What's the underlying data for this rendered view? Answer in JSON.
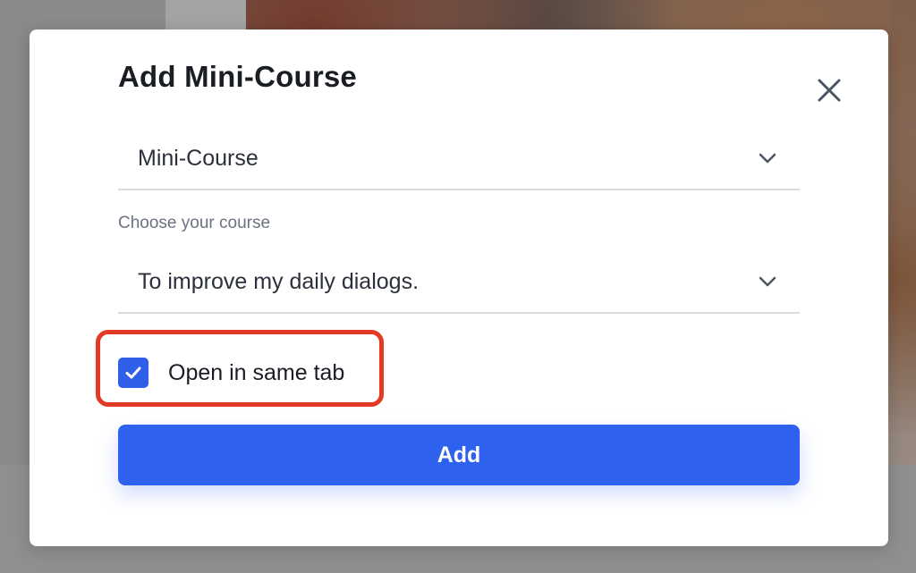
{
  "modal": {
    "title": "Add Mini-Course",
    "close_icon": "close-icon"
  },
  "type_select": {
    "value": "Mini-Course",
    "icon": "chevron-down-icon"
  },
  "course_select": {
    "label": "Choose your course",
    "value": "To improve my daily dialogs.",
    "icon": "chevron-down-icon"
  },
  "open_same_tab": {
    "label": "Open in same tab",
    "checked": true,
    "icon": "checkmark-icon"
  },
  "add_button": {
    "label": "Add"
  },
  "colors": {
    "accent": "#2f61ef",
    "checkbox": "#2f5fe8",
    "highlight": "#e23a24",
    "title_text": "#1a1d24",
    "muted_text": "#6b7280"
  }
}
